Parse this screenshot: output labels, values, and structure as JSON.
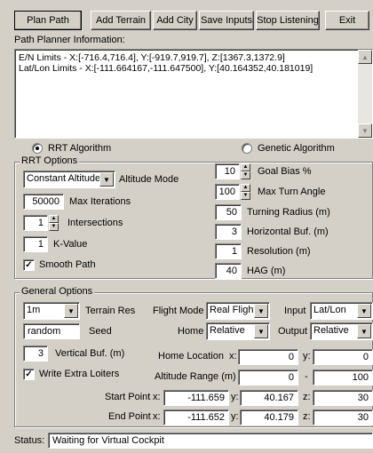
{
  "toolbar": {
    "plan_path": "Plan Path",
    "add_terrain": "Add Terrain",
    "add_city": "Add City",
    "save_inputs": "Save Inputs",
    "stop_listening": "Stop Listening",
    "exit": "Exit"
  },
  "info": {
    "label": "Path Planner Information:",
    "line1": "E/N Limits - X:[-716.4,716.4], Y:[-919.7,919.7], Z:[1367.3,1372.9]",
    "line2": "Lat/Lon Limits - X:[-111.664167,-111.647500], Y:[40.164352,40.181019]"
  },
  "algorithms": {
    "rrt_label": "RRT Algorithm",
    "rrt_selected": true,
    "genetic_label": "Genetic Algorithm"
  },
  "rrt_options": {
    "title": "RRT Options",
    "altitude_mode_value": "Constant Altitude",
    "altitude_mode_label": "Altitude Mode",
    "max_iterations_value": "50000",
    "max_iterations_label": "Max Iterations",
    "intersections_value": "1",
    "intersections_label": "Intersections",
    "k_value": "1",
    "k_value_label": "K-Value",
    "smooth_path_label": "Smooth Path",
    "smooth_path_checked": true,
    "goal_bias_value": "10",
    "goal_bias_label": "Goal Bias %",
    "max_turn_angle_value": "100",
    "max_turn_angle_label": "Max Turn Angle",
    "turning_radius_value": "50",
    "turning_radius_label": "Turning Radius (m)",
    "horizontal_buf_value": "3",
    "horizontal_buf_label": "Horizontal Buf. (m)",
    "resolution_value": "1",
    "resolution_label": "Resolution (m)",
    "hag_value": "40",
    "hag_label": "HAG (m)"
  },
  "general_options": {
    "title": "General Options",
    "terrain_res_value": "1m",
    "terrain_res_label": "Terrain Res",
    "flight_mode_label": "Flight Mode",
    "flight_mode_value": "Real Flight",
    "input_label": "Input",
    "input_value": "Lat/Lon",
    "seed_value": "random",
    "seed_label": "Seed",
    "home_label": "Home",
    "home_value": "Relative",
    "output_label": "Output",
    "output_value": "Relative",
    "vertical_buf_value": "3",
    "vertical_buf_label": "Vertical Buf. (m)",
    "home_location_label": "Home Location",
    "home_location_x": "0",
    "home_location_y": "0",
    "write_extra_loiters_label": "Write Extra Loiters",
    "write_extra_loiters_checked": true,
    "altitude_range_label": "Altitude Range (m)",
    "altitude_range_min": "0",
    "altitude_range_max": "100",
    "start_point_label": "Start Point",
    "start_x": "-111.659",
    "start_y": "40.167",
    "start_z": "30",
    "end_point_label": "End Point",
    "end_x": "-111.652",
    "end_y": "40.179",
    "end_z": "30",
    "x_label": "x:",
    "y_label": "y:",
    "z_label": "z:",
    "dash_label": "-"
  },
  "status": {
    "label": "Status:",
    "value": "Waiting for Virtual Cockpit"
  }
}
